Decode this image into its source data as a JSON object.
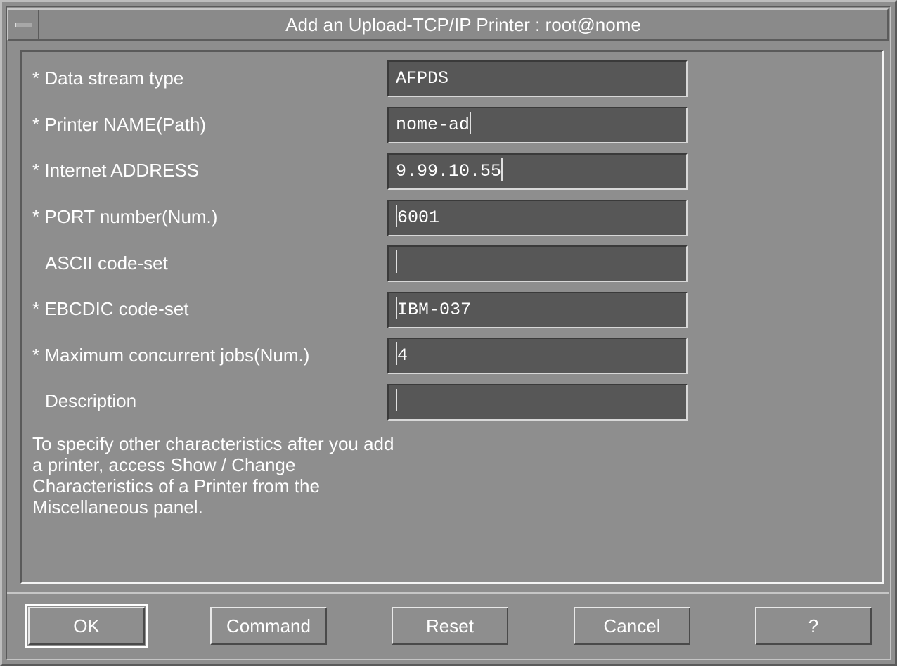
{
  "window": {
    "title": "Add an Upload-TCP/IP Printer : root@nome"
  },
  "fields": [
    {
      "label": "* Data stream type",
      "value": "AFPDS"
    },
    {
      "label": "* Printer NAME(Path)",
      "value": "nome-ad"
    },
    {
      "label": "* Internet ADDRESS",
      "value": "9.99.10.55"
    },
    {
      "label": "* PORT number(Num.)",
      "value": "6001"
    },
    {
      "label": "ASCII code-set",
      "value": ""
    },
    {
      "label": "* EBCDIC code-set",
      "value": "IBM-037"
    },
    {
      "label": "* Maximum concurrent jobs(Num.)",
      "value": "4"
    },
    {
      "label": "Description",
      "value": ""
    }
  ],
  "info": {
    "line1": "To specify other characteristics after you add",
    "line2": "a printer, access Show / Change",
    "line3": "Characteristics of a Printer from the",
    "line4": "Miscellaneous panel."
  },
  "buttons": {
    "ok": "OK",
    "command": "Command",
    "reset": "Reset",
    "cancel": "Cancel",
    "help": "?"
  }
}
